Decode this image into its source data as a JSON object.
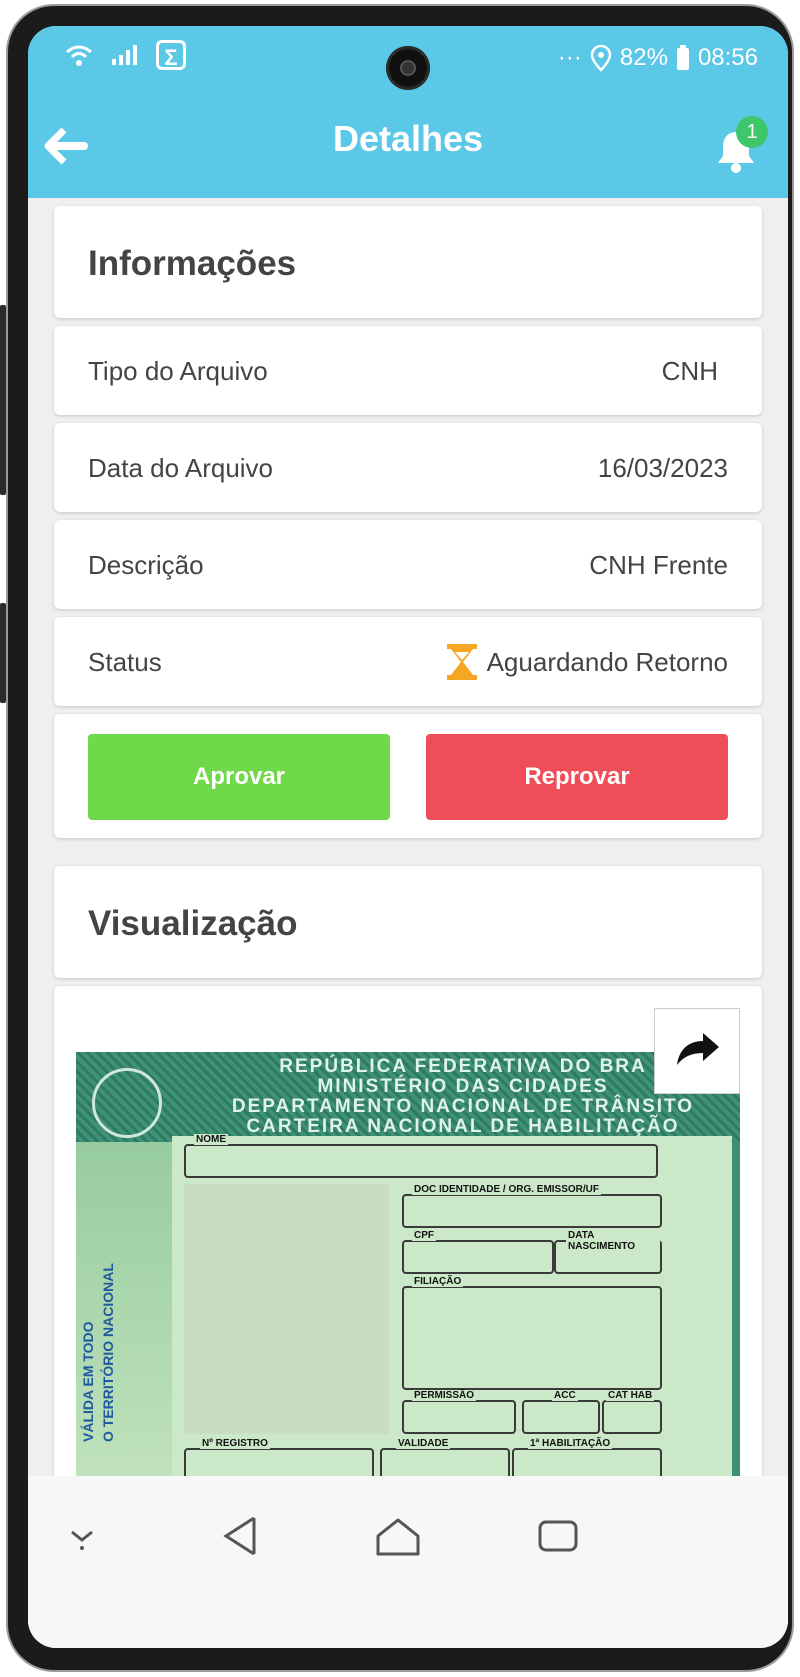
{
  "status_bar": {
    "battery": "82%",
    "time": "08:56",
    "more_glyph": "···",
    "app_icon_glyph": "Σ"
  },
  "appbar": {
    "title": "Detalhes",
    "notification_count": "1"
  },
  "info_section": {
    "heading": "Informações",
    "rows": [
      {
        "label": "Tipo do Arquivo",
        "value": "CNH"
      },
      {
        "label": "Data do Arquivo",
        "value": "16/03/2023"
      },
      {
        "label": "Descrição",
        "value": "CNH Frente"
      },
      {
        "label": "Status",
        "value": "Aguardando Retorno",
        "icon": "hourglass-icon"
      }
    ]
  },
  "actions": {
    "approve_label": "Aprovar",
    "reject_label": "Reprovar"
  },
  "preview_section": {
    "heading": "Visualização"
  },
  "document": {
    "header_lines": [
      "REPÚBLICA FEDERATIVA DO BRA",
      "MINISTÉRIO DAS CIDADES",
      "DEPARTAMENTO NACIONAL DE TRÂNSITO",
      "CARTEIRA NACIONAL DE HABILITAÇÃO"
    ],
    "field_labels": {
      "nome": "NOME",
      "doc_id": "DOC IDENTIDADE / ORG. EMISSOR/UF",
      "cpf": "CPF",
      "data_nasc": "DATA NASCIMENTO",
      "filiacao": "FILIAÇÃO",
      "permissao": "PERMISSÃO",
      "acc": "ACC",
      "cat_hab": "CAT HAB",
      "registro": "Nº REGISTRO",
      "validade": "VALIDADE",
      "habilitacao": "1ª HABILITAÇÃO"
    },
    "vertical_text_1": "VÁLIDA EM TODO",
    "vertical_text_2": "O TERRITÓRIO NACIONAL"
  },
  "colors": {
    "primary": "#5ac8e6",
    "approve": "#6fd94a",
    "reject": "#ef4d57",
    "pending": "#f5a623",
    "badge": "#3ec66a"
  }
}
